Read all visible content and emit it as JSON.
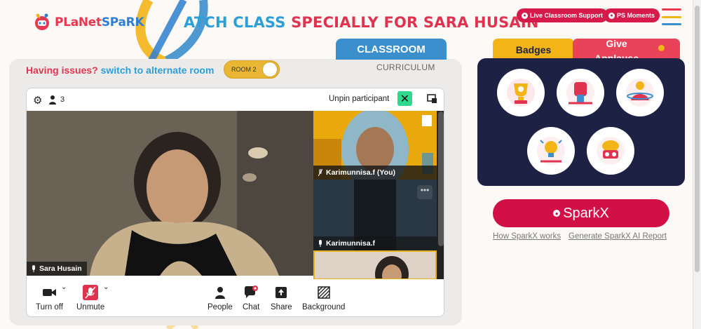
{
  "header": {
    "logo_part1": "PLaNet",
    "logo_part2": "SPaRK",
    "title_part1": "ATCH CLASS ",
    "title_part2": "SPECIALLY FOR SARA HUSAIN",
    "live_support_label": "Live Classroom Support",
    "ps_moments_label": "PS Moments"
  },
  "tabs": {
    "classroom": "CLASSROOM",
    "curriculum": "CURRICULUM"
  },
  "room": {
    "issues_text": "Having issues?",
    "switch_text": "switch to alternate room",
    "toggle_label": "ROOM 2"
  },
  "video": {
    "participant_count": "3",
    "unpin_label": "Unpin participant",
    "main_participant": "Sara Husain",
    "tile1_name": "Karimunnisa.f (You)",
    "tile2_name": "Karimunnisa.f",
    "dots": "•••"
  },
  "toolbar": {
    "camera_label": "Turn off",
    "mic_label": "Unmute",
    "people_label": "People",
    "chat_label": "Chat",
    "share_label": "Share",
    "background_label": "Background"
  },
  "right": {
    "badges_tab": "Badges",
    "applause_line1": "Give",
    "applause_line2": "Applause",
    "sparkx_label": "SparkX",
    "how_sparkx": "How SparkX works",
    "generate_report": "Generate SparkX AI Report"
  },
  "colors": {
    "accent_red": "#d61b4b",
    "accent_blue": "#3b8fcc",
    "badge_panel": "#1d2244",
    "badge_tab": "#f2b417",
    "unpin_green": "#2fd88c"
  }
}
